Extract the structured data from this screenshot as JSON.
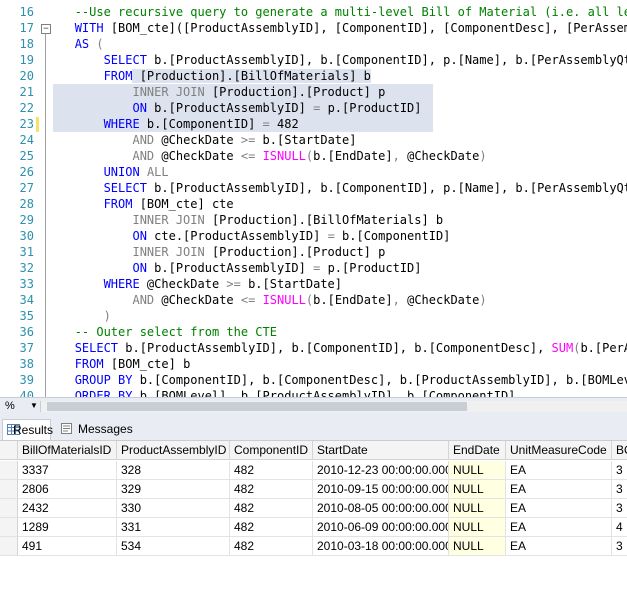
{
  "editor": {
    "lines": [
      {
        "num": "16",
        "segments": [
          {
            "t": "   ",
            "c": ""
          },
          {
            "t": "--Use recursive query to generate a multi-level Bill of Material (i.e. all lev",
            "c": "cm"
          }
        ]
      },
      {
        "num": "17",
        "segments": [
          {
            "t": "   ",
            "c": ""
          },
          {
            "t": "WITH",
            "c": "kw"
          },
          {
            "t": " [BOM_cte]([ProductAssemblyID], [ComponentID], [ComponentDesc], [PerAssemb",
            "c": ""
          }
        ]
      },
      {
        "num": "18",
        "segments": [
          {
            "t": "   ",
            "c": ""
          },
          {
            "t": "AS",
            "c": "kw"
          },
          {
            "t": " ",
            "c": ""
          },
          {
            "t": "(",
            "c": "op"
          }
        ]
      },
      {
        "num": "19",
        "segments": [
          {
            "t": "       ",
            "c": ""
          },
          {
            "t": "SELECT",
            "c": "kw"
          },
          {
            "t": " b.[ProductAssemblyID], b.[ComponentID], p.[Name], b.[PerAssemblyQty",
            "c": ""
          }
        ]
      },
      {
        "num": "20",
        "segments": [
          {
            "t": "       ",
            "c": ""
          },
          {
            "t": "FROM",
            "c": "kw"
          },
          {
            "t": " [Production].[BillOfMaterials] b",
            "c": "hl"
          }
        ]
      },
      {
        "num": "21",
        "hl": true,
        "segments": [
          {
            "t": "           ",
            "c": ""
          },
          {
            "t": "INNER JOIN",
            "c": "op"
          },
          {
            "t": " [Production].[Product] p",
            "c": ""
          }
        ]
      },
      {
        "num": "22",
        "hl": true,
        "segments": [
          {
            "t": "           ",
            "c": ""
          },
          {
            "t": "ON",
            "c": "kw"
          },
          {
            "t": " b.[ProductAssemblyID] ",
            "c": ""
          },
          {
            "t": "=",
            "c": "op"
          },
          {
            "t": " p.[ProductID]",
            "c": ""
          }
        ]
      },
      {
        "num": "23",
        "hl": true,
        "segments": [
          {
            "t": "       ",
            "c": ""
          },
          {
            "t": "WHERE",
            "c": "kw"
          },
          {
            "t": " b.[ComponentID] ",
            "c": ""
          },
          {
            "t": "=",
            "c": "op"
          },
          {
            "t": " 482",
            "c": ""
          }
        ]
      },
      {
        "num": "24",
        "segments": [
          {
            "t": "           ",
            "c": ""
          },
          {
            "t": "AND",
            "c": "op"
          },
          {
            "t": " @CheckDate ",
            "c": ""
          },
          {
            "t": ">=",
            "c": "op"
          },
          {
            "t": " b.[StartDate]",
            "c": ""
          }
        ]
      },
      {
        "num": "25",
        "segments": [
          {
            "t": "           ",
            "c": ""
          },
          {
            "t": "AND",
            "c": "op"
          },
          {
            "t": " @CheckDate ",
            "c": ""
          },
          {
            "t": "<=",
            "c": "op"
          },
          {
            "t": " ",
            "c": ""
          },
          {
            "t": "ISNULL",
            "c": "fn"
          },
          {
            "t": "(",
            "c": "op"
          },
          {
            "t": "b.[EndDate]",
            "c": ""
          },
          {
            "t": ",",
            "c": "op"
          },
          {
            "t": " @CheckDate",
            "c": ""
          },
          {
            "t": ")",
            "c": "op"
          }
        ]
      },
      {
        "num": "26",
        "segments": [
          {
            "t": "       ",
            "c": ""
          },
          {
            "t": "UNION",
            "c": "kw"
          },
          {
            "t": " ",
            "c": ""
          },
          {
            "t": "ALL",
            "c": "op"
          }
        ]
      },
      {
        "num": "27",
        "segments": [
          {
            "t": "       ",
            "c": ""
          },
          {
            "t": "SELECT",
            "c": "kw"
          },
          {
            "t": " b.[ProductAssemblyID], b.[ComponentID], p.[Name], b.[PerAssemblyQty",
            "c": ""
          }
        ]
      },
      {
        "num": "28",
        "segments": [
          {
            "t": "       ",
            "c": ""
          },
          {
            "t": "FROM",
            "c": "kw"
          },
          {
            "t": " [BOM_cte] cte",
            "c": ""
          }
        ]
      },
      {
        "num": "29",
        "segments": [
          {
            "t": "           ",
            "c": ""
          },
          {
            "t": "INNER JOIN",
            "c": "op"
          },
          {
            "t": " [Production].[BillOfMaterials] b",
            "c": ""
          }
        ]
      },
      {
        "num": "30",
        "segments": [
          {
            "t": "           ",
            "c": ""
          },
          {
            "t": "ON",
            "c": "kw"
          },
          {
            "t": " cte.[ProductAssemblyID] ",
            "c": ""
          },
          {
            "t": "=",
            "c": "op"
          },
          {
            "t": " b.[ComponentID]",
            "c": ""
          }
        ]
      },
      {
        "num": "31",
        "segments": [
          {
            "t": "           ",
            "c": ""
          },
          {
            "t": "INNER JOIN",
            "c": "op"
          },
          {
            "t": " [Production].[Product] p",
            "c": ""
          }
        ]
      },
      {
        "num": "32",
        "segments": [
          {
            "t": "           ",
            "c": ""
          },
          {
            "t": "ON",
            "c": "kw"
          },
          {
            "t": " b.[ProductAssemblyID] ",
            "c": ""
          },
          {
            "t": "=",
            "c": "op"
          },
          {
            "t": " p.[ProductID]",
            "c": ""
          }
        ]
      },
      {
        "num": "33",
        "segments": [
          {
            "t": "       ",
            "c": ""
          },
          {
            "t": "WHERE",
            "c": "kw"
          },
          {
            "t": " @CheckDate ",
            "c": ""
          },
          {
            "t": ">=",
            "c": "op"
          },
          {
            "t": " b.[StartDate]",
            "c": ""
          }
        ]
      },
      {
        "num": "34",
        "segments": [
          {
            "t": "           ",
            "c": ""
          },
          {
            "t": "AND",
            "c": "op"
          },
          {
            "t": " @CheckDate ",
            "c": ""
          },
          {
            "t": "<=",
            "c": "op"
          },
          {
            "t": " ",
            "c": ""
          },
          {
            "t": "ISNULL",
            "c": "fn"
          },
          {
            "t": "(",
            "c": "op"
          },
          {
            "t": "b.[EndDate]",
            "c": ""
          },
          {
            "t": ",",
            "c": "op"
          },
          {
            "t": " @CheckDate",
            "c": ""
          },
          {
            "t": ")",
            "c": "op"
          }
        ]
      },
      {
        "num": "35",
        "segments": [
          {
            "t": "       ",
            "c": ""
          },
          {
            "t": ")",
            "c": "op"
          }
        ]
      },
      {
        "num": "36",
        "segments": [
          {
            "t": "   ",
            "c": ""
          },
          {
            "t": "-- Outer select from the CTE",
            "c": "cm"
          }
        ]
      },
      {
        "num": "37",
        "segments": [
          {
            "t": "   ",
            "c": ""
          },
          {
            "t": "SELECT",
            "c": "kw"
          },
          {
            "t": " b.[ProductAssemblyID], b.[ComponentID], b.[ComponentDesc], ",
            "c": ""
          },
          {
            "t": "SUM",
            "c": "fn"
          },
          {
            "t": "(",
            "c": "op"
          },
          {
            "t": "b.[PerAs",
            "c": ""
          }
        ]
      },
      {
        "num": "38",
        "segments": [
          {
            "t": "   ",
            "c": ""
          },
          {
            "t": "FROM",
            "c": "kw"
          },
          {
            "t": " [BOM_cte] b",
            "c": ""
          }
        ]
      },
      {
        "num": "39",
        "segments": [
          {
            "t": "   ",
            "c": ""
          },
          {
            "t": "GROUP BY",
            "c": "kw"
          },
          {
            "t": " b.[ComponentID], b.[ComponentDesc], b.[ProductAssemblyID], b.[BOMLeve",
            "c": ""
          }
        ]
      },
      {
        "num": "40",
        "segments": [
          {
            "t": "   ",
            "c": ""
          },
          {
            "t": "ORDER BY",
            "c": "kw"
          },
          {
            "t": " b.[BOMLevel], b.[ProductAssemblyID], b.[ComponentID]",
            "c": ""
          }
        ]
      }
    ],
    "collapse_glyph": "⊟"
  },
  "zoom": {
    "value": "%",
    "caret": "▼"
  },
  "tabs": [
    {
      "label": "Results",
      "active": true,
      "icon": "grid-icon"
    },
    {
      "label": "Messages",
      "active": false,
      "icon": "messages-icon"
    }
  ],
  "grid": {
    "columns": [
      "BillOfMaterialsID",
      "ProductAssemblyID",
      "ComponentID",
      "StartDate",
      "EndDate",
      "UnitMeasureCode",
      "BO"
    ],
    "rows": [
      {
        "cells": [
          "3337",
          "328",
          "482",
          "2010-12-23 00:00:00.000",
          "NULL",
          "EA",
          "3"
        ]
      },
      {
        "cells": [
          "2806",
          "329",
          "482",
          "2010-09-15 00:00:00.000",
          "NULL",
          "EA",
          "3"
        ]
      },
      {
        "cells": [
          "2432",
          "330",
          "482",
          "2010-08-05 00:00:00.000",
          "NULL",
          "EA",
          "3"
        ]
      },
      {
        "cells": [
          "1289",
          "331",
          "482",
          "2010-06-09 00:00:00.000",
          "NULL",
          "EA",
          "4"
        ]
      },
      {
        "cells": [
          "491",
          "534",
          "482",
          "2010-03-18 00:00:00.000",
          "NULL",
          "EA",
          "3"
        ]
      }
    ]
  },
  "colors": {
    "keyword": "#0000ff",
    "function": "#ff00ff",
    "comment": "#008000",
    "operator": "#808080",
    "line_number": "#2b91af",
    "selection_highlight": "#dde3ee",
    "null_cell": "#ffffe1"
  }
}
